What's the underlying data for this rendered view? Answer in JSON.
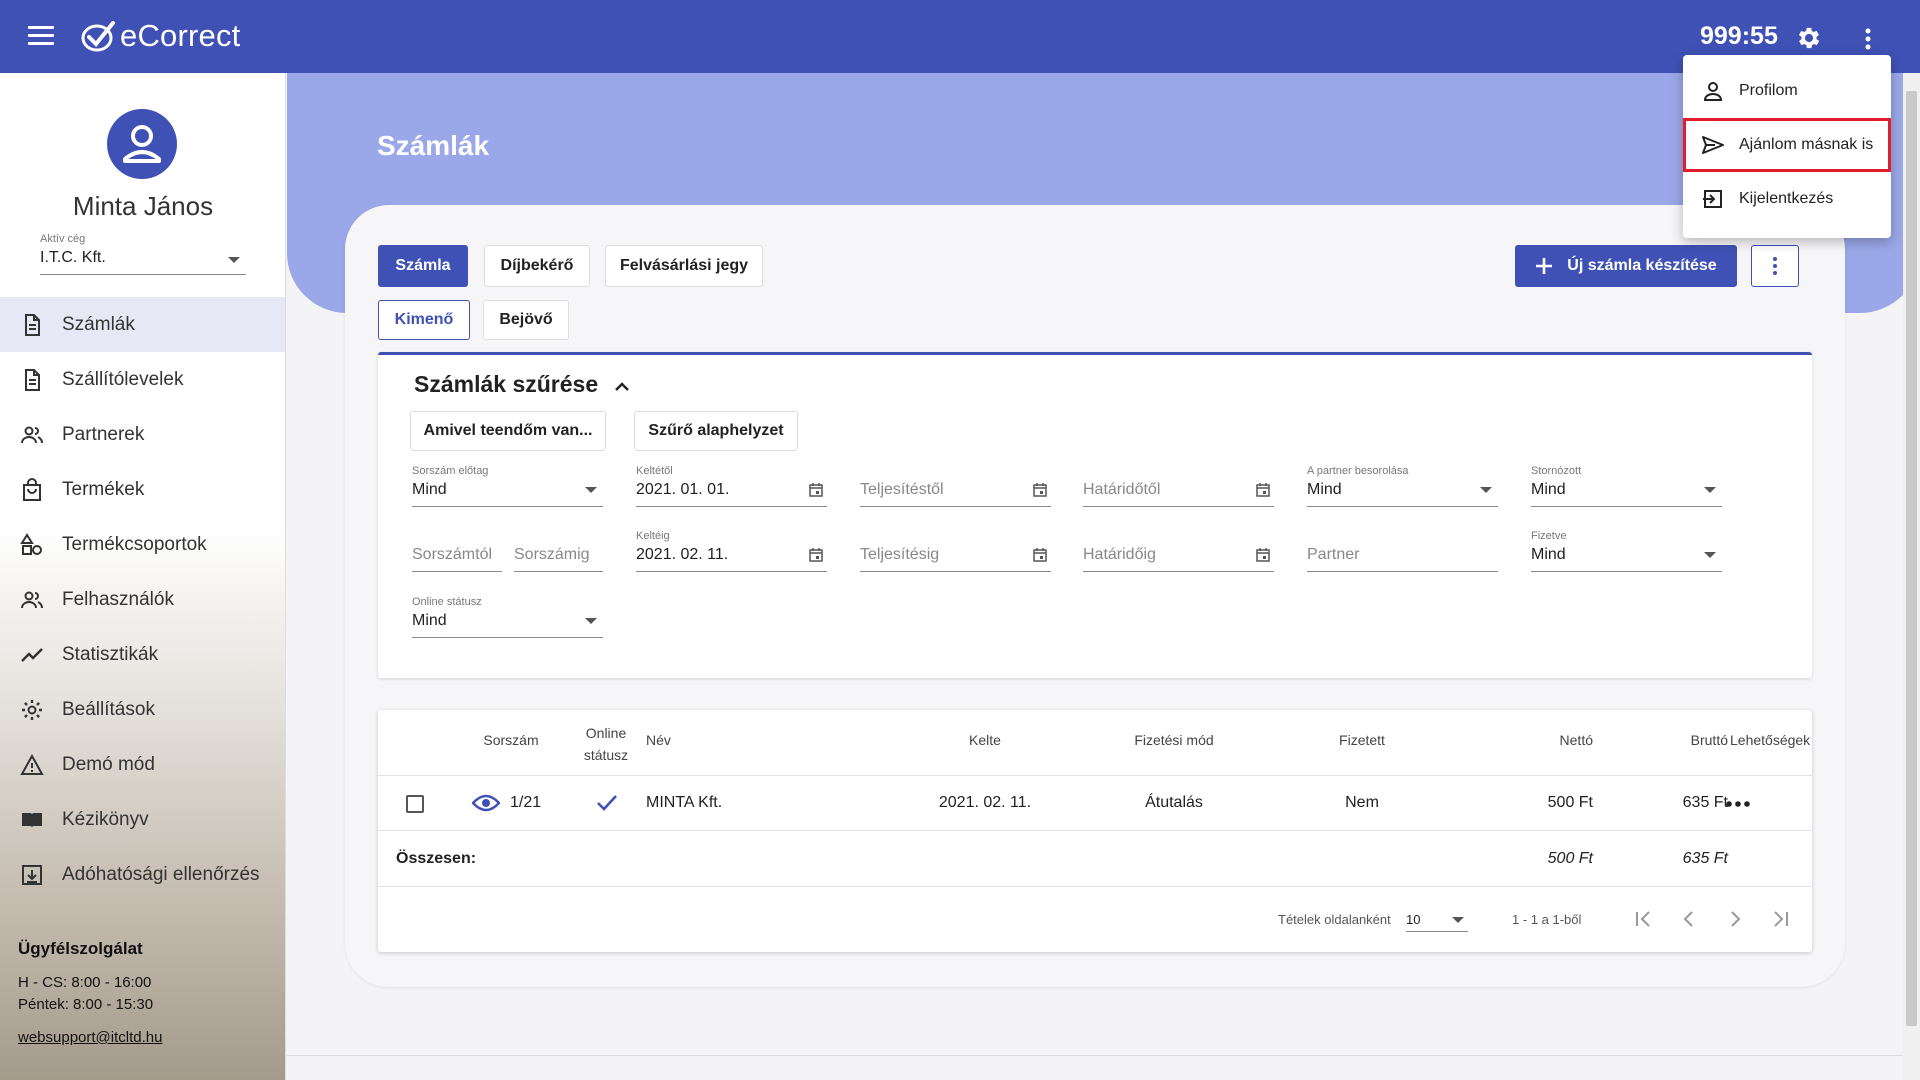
{
  "topbar": {
    "logo_text": "eCorrect",
    "timer": "999:55"
  },
  "sidebar": {
    "user_name": "Minta János",
    "company_label": "Aktív cég",
    "company_value": "I.T.C. Kft.",
    "items": [
      {
        "label": "Számlák",
        "icon": "document-icon"
      },
      {
        "label": "Szállítólevelek",
        "icon": "document-icon"
      },
      {
        "label": "Partnerek",
        "icon": "people-icon"
      },
      {
        "label": "Termékek",
        "icon": "bag-icon"
      },
      {
        "label": "Termékcsoportok",
        "icon": "shapes-icon"
      },
      {
        "label": "Felhasználók",
        "icon": "people-icon"
      },
      {
        "label": "Statisztikák",
        "icon": "trend-icon"
      },
      {
        "label": "Beállítások",
        "icon": "gear-icon"
      },
      {
        "label": "Demó mód",
        "icon": "warning-icon"
      },
      {
        "label": "Kézikönyv",
        "icon": "book-icon"
      },
      {
        "label": "Adóhatósági ellenőrzés",
        "icon": "archive-icon"
      }
    ],
    "support": {
      "title": "Ügyfélszolgálat",
      "hours1": "H - CS: 8:00 - 16:00",
      "hours2": "Péntek: 8:00 - 15:30",
      "email": "websupport@itcltd.hu"
    }
  },
  "main": {
    "title": "Számlák",
    "doc_tabs": [
      "Számla",
      "Díjbekérő",
      "Felvásárlási jegy"
    ],
    "direction_tabs": [
      "Kimenő",
      "Bejövő"
    ],
    "new_invoice_label": "Új számla készítése"
  },
  "filter": {
    "title": "Számlák szűrése",
    "todo_button": "Amivel teendőm van...",
    "reset_button": "Szűrő alaphelyzet",
    "fields": {
      "prefix": {
        "label": "Sorszám előtag",
        "value": "Mind"
      },
      "issued_from": {
        "label": "Keltétől",
        "value": "2021. 01. 01."
      },
      "fulfil_from": {
        "placeholder": "Teljesítéstől"
      },
      "due_from": {
        "placeholder": "Határidőtől"
      },
      "partner_class": {
        "label": "A partner besorolása",
        "value": "Mind"
      },
      "cancelled": {
        "label": "Stornózott",
        "value": "Mind"
      },
      "num_from": {
        "placeholder": "Sorszámtól"
      },
      "num_to": {
        "placeholder": "Sorszámig"
      },
      "issued_to": {
        "label": "Keltéig",
        "value": "2021. 02. 11."
      },
      "fulfil_to": {
        "placeholder": "Teljesítésig"
      },
      "due_to": {
        "placeholder": "Határidőig"
      },
      "partner": {
        "placeholder": "Partner"
      },
      "paid": {
        "label": "Fizetve",
        "value": "Mind"
      },
      "online_status": {
        "label": "Online státusz",
        "value": "Mind"
      }
    }
  },
  "table": {
    "headers": {
      "number": "Sorszám",
      "online1": "Online",
      "online2": "státusz",
      "name": "Név",
      "date": "Kelte",
      "payment": "Fizetési mód",
      "paid": "Fizetett",
      "net": "Nettó",
      "gross": "Bruttó",
      "options": "Lehetőségek"
    },
    "row": {
      "number": "1/21",
      "name": "MINTA Kft.",
      "date": "2021. 02. 11.",
      "payment": "Átutalás",
      "paid": "Nem",
      "net": "500 Ft",
      "gross": "635 Ft"
    },
    "total": {
      "label": "Összesen:",
      "net": "500 Ft",
      "gross": "635 Ft"
    },
    "pager": {
      "per_page_label": "Tételek oldalanként",
      "per_page_value": "10",
      "range": "1 - 1 a 1-ből"
    }
  },
  "user_menu": {
    "items": [
      {
        "label": "Profilom",
        "icon": "person-icon"
      },
      {
        "label": "Ajánlom másnak is",
        "icon": "send-icon"
      },
      {
        "label": "Kijelentkezés",
        "icon": "logout-icon"
      }
    ]
  },
  "colors": {
    "primary": "#3f51b5",
    "hero": "#9aa7e8",
    "highlight": "#e11d2b"
  }
}
